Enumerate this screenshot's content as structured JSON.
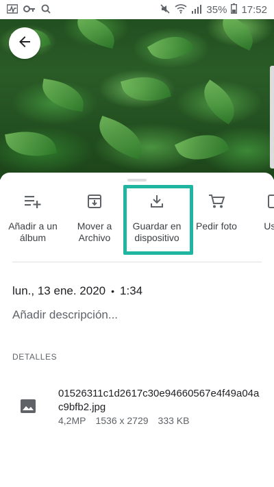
{
  "status_bar": {
    "battery_percent": "35%",
    "time": "17:52",
    "icons": [
      "activity-icon",
      "key-icon",
      "search-icon",
      "mute-icon",
      "wifi-icon",
      "signal-icon",
      "battery-icon"
    ]
  },
  "photo": {
    "back_icon": "arrow-back-icon"
  },
  "actions": [
    {
      "label": "Añadir a un álbum",
      "icon": "playlist-add-icon"
    },
    {
      "label": "Mover a Archivo",
      "icon": "archive-icon"
    },
    {
      "label": "Guardar en dispositivo",
      "icon": "download-icon",
      "highlighted": true
    },
    {
      "label": "Pedir foto",
      "icon": "cart-icon"
    },
    {
      "label": "Usar",
      "icon": "use-icon"
    }
  ],
  "info": {
    "date": "lun., 13 ene. 2020",
    "time": "1:34",
    "description_placeholder": "Añadir descripción..."
  },
  "details": {
    "header": "DETALLES",
    "file_name": "01526311c1d2617c30e94660567e4f49a04ac9bfb2.jpg",
    "megapixels": "4,2MP",
    "dimensions": "1536 x 2729",
    "size": "333 KB"
  },
  "colors": {
    "highlight": "#1fb5a0"
  }
}
